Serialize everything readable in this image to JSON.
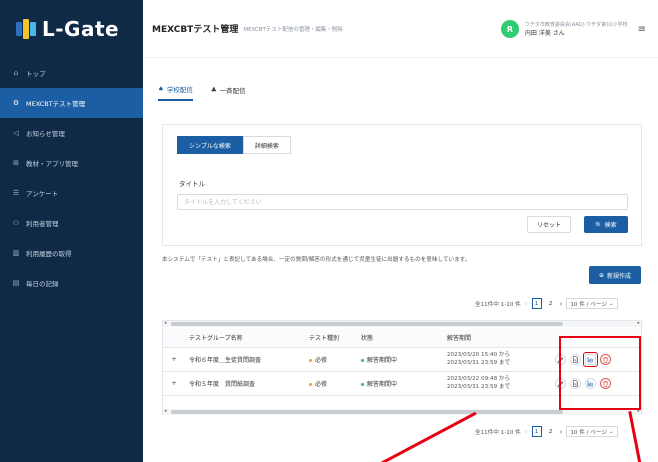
{
  "brand": {
    "name": "L-Gate",
    "colors": [
      "#2c6fbf",
      "#f2c230",
      "#47b7e8"
    ]
  },
  "sidebar": {
    "items": [
      {
        "icon": "home-icon",
        "glyph": "⌂",
        "label": "トップ",
        "active": false
      },
      {
        "icon": "gear-icon",
        "glyph": "⚙",
        "label": "MEXCBTテスト管理",
        "active": true
      },
      {
        "icon": "megaphone-icon",
        "glyph": "◁",
        "label": "お知らせ管理",
        "active": false
      },
      {
        "icon": "grid-icon",
        "glyph": "⊞",
        "label": "教材・アプリ管理",
        "active": false
      },
      {
        "icon": "survey-icon",
        "glyph": "☰",
        "label": "アンケート",
        "active": false
      },
      {
        "icon": "users-icon",
        "glyph": "⚇",
        "label": "利用者管理",
        "active": false
      },
      {
        "icon": "chart-icon",
        "glyph": "▥",
        "label": "利用履歴の取得",
        "active": false
      },
      {
        "icon": "calendar-icon",
        "glyph": "▤",
        "label": "毎日の記録",
        "active": false
      }
    ]
  },
  "header": {
    "title": "MEXCBTテスト管理",
    "subtitle": "MEXCBTテスト配信の管理・編集・削除",
    "avatar_letter": "R",
    "org": "ウチダ市教育委員会(AAD) ウチダ第10小学校",
    "user": "内田 洋美 さん"
  },
  "tabs": [
    {
      "label": "学校配信",
      "icon": "school-icon",
      "glyph": "♠",
      "active": true
    },
    {
      "label": "一斉配信",
      "icon": "broadcast-icon",
      "glyph": "♣",
      "active": false
    }
  ],
  "search": {
    "mode_simple": "シンプルな検索",
    "mode_detail": "詳細検索",
    "title_label": "タイトル",
    "title_placeholder": "タイトルを入力してください",
    "title_value": "",
    "reset_label": "リセット",
    "search_label": "🔍 検索"
  },
  "notice": "本システムで「テスト」と表記してある場合、一定の質問/解答の形式を通じて児童生徒に出題するものを意味しています。",
  "new_button": "新規作成",
  "pagination": {
    "summary": "全11件中 1-10 件",
    "pages": [
      "1",
      "2"
    ],
    "current": "1",
    "page_size": "10 件 / ページ"
  },
  "table": {
    "headers": [
      "",
      "テストグループ名称",
      "テスト種別",
      "状態",
      "解答期間",
      ""
    ],
    "rows": [
      {
        "expand": "+",
        "name": "令和６年度＿生徒質問調査",
        "type": "必修",
        "type_color": "#f0a020",
        "status": "解答期間中",
        "status_color": "#2fbf71",
        "period_from": "2023/03/20 15:40 から",
        "period_to": "2023/03/31 23:59 まで",
        "highlight_chart": true
      },
      {
        "expand": "+",
        "name": "令和５年度　質問紙調査",
        "type": "必修",
        "type_color": "#f0a020",
        "status": "解答期間中",
        "status_color": "#2fbf71",
        "period_from": "2023/03/22 09:48 から",
        "period_to": "2023/03/31 23:59 まで",
        "highlight_chart": false
      }
    ],
    "action_icons": [
      "edit-icon",
      "document-icon",
      "chart-icon",
      "delete-icon"
    ]
  },
  "annotation_color": "#e60012"
}
